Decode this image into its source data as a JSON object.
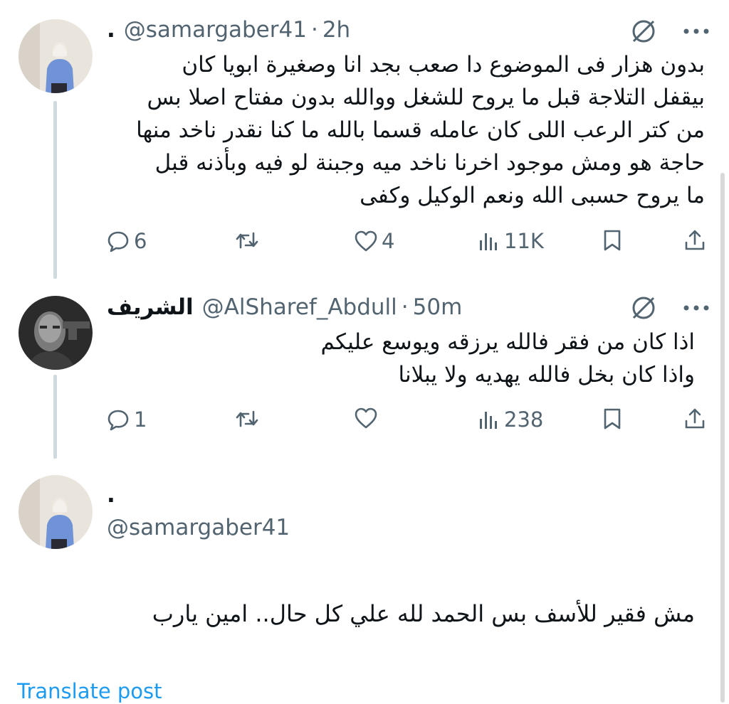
{
  "tweets": [
    {
      "name": ".",
      "handle": "@samargaber41",
      "separator": "·",
      "time": "2h",
      "text_lines": [
        "بدون هزار فى الموضوع دا صعب بجد انا وصغيرة ابويا كان",
        "بيقفل التلاجة قبل ما يروح للشغل ووالله بدون مفتاح اصلا بس",
        "من كتر الرعب اللى كان عامله قسما بالله ما كنا نقدر ناخد منها",
        "حاجة هو ومش موجود اخرنا ناخد ميه وجبنة لو فيه وبأذنه قبل",
        "ما يروح حسبى الله ونعم الوكيل وكفى"
      ],
      "replies": "6",
      "retweets": "",
      "likes": "4",
      "views": "11K"
    },
    {
      "name": "الشريف",
      "handle": "@AlSharef_Abdull",
      "separator": "·",
      "time": "50m",
      "text_lines": [
        "اذا كان من فقر فالله يرزقه ويوسع عليكم",
        "واذا كان بخل فالله يهديه ولا يبلانا"
      ],
      "replies": "1",
      "retweets": "",
      "likes": "",
      "views": "238"
    }
  ],
  "main_post": {
    "name": ".",
    "handle": "@samargaber41",
    "text": "مش فقير للأسف بس الحمد لله علي كل حال.. امين يارب",
    "translate_label": "Translate post"
  },
  "icons": {
    "grok": "grok-icon",
    "more": "more-icon",
    "reply": "reply-icon",
    "retweet": "retweet-icon",
    "like": "like-icon",
    "views": "views-icon",
    "bookmark": "bookmark-icon",
    "share": "share-icon"
  },
  "colors": {
    "text": "#0f1419",
    "muted": "#536471",
    "link": "#1d9bf0",
    "thread_line": "#cfd9de"
  }
}
